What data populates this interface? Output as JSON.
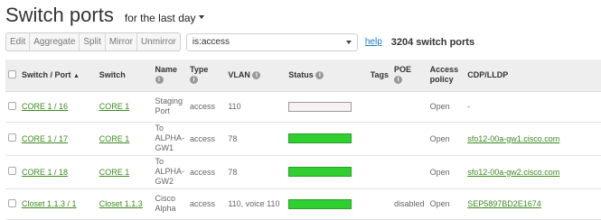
{
  "header": {
    "title": "Switch ports",
    "range_label": "for the last day"
  },
  "toolbar": {
    "buttons": [
      "Edit",
      "Aggregate",
      "Split",
      "Mirror",
      "Unmirror"
    ],
    "search_value": "is:access",
    "help_label": "help",
    "count_label": "3204 switch ports"
  },
  "table": {
    "columns": {
      "switch_port": "Switch / Port",
      "switch": "Switch",
      "name": "Name",
      "type": "Type",
      "vlan": "VLAN",
      "status": "Status",
      "tags": "Tags",
      "poe": "POE",
      "access_policy_line1": "Access",
      "access_policy_line2": "policy",
      "cdp": "CDP/LLDP"
    },
    "sort_arrow": "▲",
    "info_glyph": "i",
    "rows": [
      {
        "port": "CORE 1 / 16",
        "switch": "CORE 1",
        "name_lines": [
          "Staging",
          "Port"
        ],
        "type": "access",
        "vlan": "110",
        "status": "empty",
        "tags": "",
        "poe": "",
        "policy": "Open",
        "cdp": "-"
      },
      {
        "port": "CORE 1 / 17",
        "switch": "CORE 1",
        "name_lines": [
          "To",
          "ALPHA-",
          "GW1"
        ],
        "type": "access",
        "vlan": "78",
        "status": "green",
        "tags": "",
        "poe": "",
        "policy": "Open",
        "cdp": "sfo12-00a-gw1.cisco.com"
      },
      {
        "port": "CORE 1 / 18",
        "switch": "CORE 1",
        "name_lines": [
          "To",
          "ALPHA-",
          "GW2"
        ],
        "type": "access",
        "vlan": "78",
        "status": "green",
        "tags": "",
        "poe": "",
        "policy": "Open",
        "cdp": "sfo12-00a-gw2.cisco.com"
      },
      {
        "port": "Closet 1.1.3 / 1",
        "switch": "Closet 1.1.3",
        "name_lines": [
          "Cisco",
          "Alpha"
        ],
        "type": "access",
        "vlan": "110, voice 110",
        "status": "green",
        "tags": "",
        "poe": "disabled",
        "policy": "Open",
        "cdp": "SEP5897BD2E1674"
      }
    ]
  },
  "colors": {
    "status_green": "#2fcf2f",
    "link_green": "#3b8a1e",
    "help_blue": "#1a7bc6"
  }
}
